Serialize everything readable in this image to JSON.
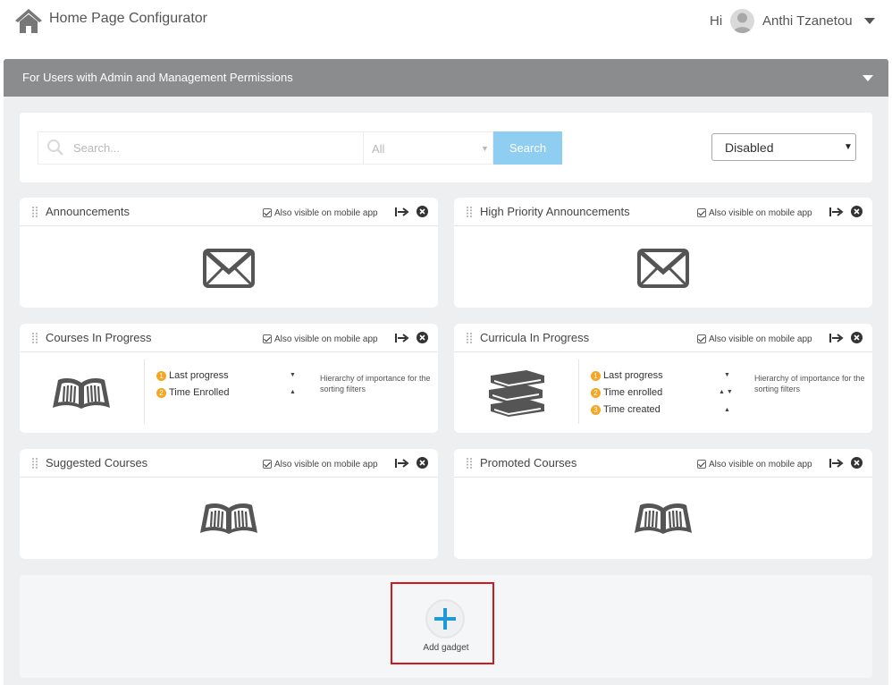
{
  "header": {
    "title": "Home Page Configurator",
    "greeting": "Hi",
    "user_name": "Anthi Tzanetou"
  },
  "section": {
    "title": "For Users with Admin and Management Permissions"
  },
  "search": {
    "placeholder": "Search...",
    "filter_value": "All",
    "button_label": "Search",
    "status_value": "Disabled"
  },
  "gadgets": [
    {
      "title": "Announcements",
      "mobile_label": "Also visible on mobile app",
      "mobile_checked": true,
      "icon": "envelope-icon"
    },
    {
      "title": "High Priority Announcements",
      "mobile_label": "Also visible on mobile app",
      "mobile_checked": true,
      "icon": "envelope-icon"
    },
    {
      "title": "Courses In Progress",
      "mobile_label": "Also visible on mobile app",
      "mobile_checked": true,
      "icon": "open-book-icon",
      "sort_items": [
        {
          "num": "1",
          "label": "Last progress"
        },
        {
          "num": "2",
          "label": "Time Enrolled"
        }
      ],
      "note": "Hierarchy of importance for the sorting filters"
    },
    {
      "title": "Curricula In Progress",
      "mobile_label": "Also visible on mobile app",
      "mobile_checked": true,
      "icon": "book-stack-icon",
      "sort_items": [
        {
          "num": "1",
          "label": "Last progress"
        },
        {
          "num": "2",
          "label": "Time enrolled"
        },
        {
          "num": "3",
          "label": "Time created"
        }
      ],
      "note": "Hierarchy of importance for the sorting filters"
    },
    {
      "title": "Suggested Courses",
      "mobile_label": "Also visible on mobile app",
      "mobile_checked": true,
      "icon": "open-book-icon"
    },
    {
      "title": "Promoted Courses",
      "mobile_label": "Also visible on mobile app",
      "mobile_checked": true,
      "icon": "open-book-icon"
    }
  ],
  "add_gadget": {
    "label": "Add gadget"
  },
  "colors": {
    "accent": "#8fcdf1",
    "section_bar": "#8a8c8e",
    "plus": "#1e9ad8",
    "highlight": "#d0191f",
    "badge": "#f5a623"
  }
}
